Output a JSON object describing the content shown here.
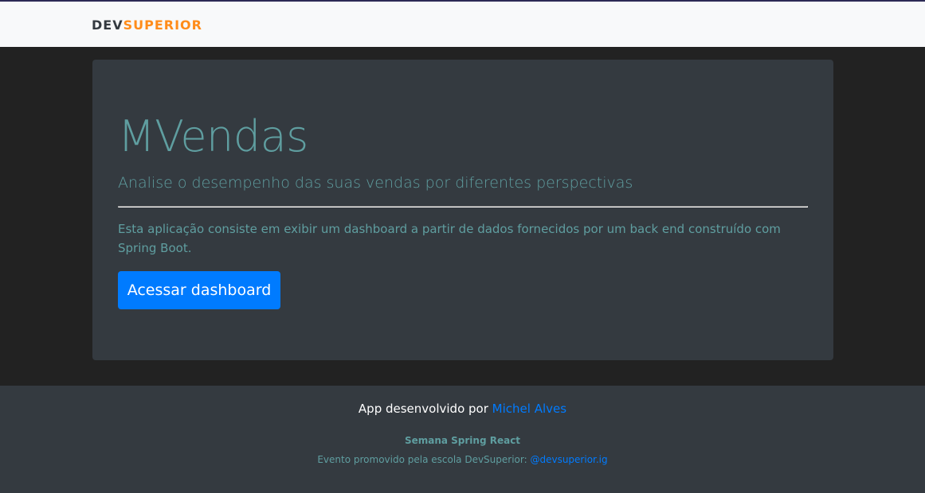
{
  "navbar": {
    "brand_dev": "DEV",
    "brand_superior": "SUPERIOR"
  },
  "hero": {
    "title": "MVendas",
    "lead": "Analise o desempenho das suas vendas por diferentes perspectivas",
    "description": "Esta aplicação consiste em exibir um dashboard a partir de dados fornecidos por um back end construído com Spring Boot.",
    "button_label": "Acessar dashboard"
  },
  "footer": {
    "credit_prefix": "App desenvolvido por ",
    "credit_author": "Michel Alves",
    "event_name": "Semana Spring React",
    "event_prefix": "Evento promovido pela escola DevSuperior: ",
    "event_link": "@devsuperior.ig"
  },
  "colors": {
    "background": "#222222",
    "navbar": "#f8f9fa",
    "card": "#343a40",
    "accent_teal": "#5f9ea0",
    "primary_blue": "#007bff",
    "brand_orange": "#ff8c1a"
  }
}
